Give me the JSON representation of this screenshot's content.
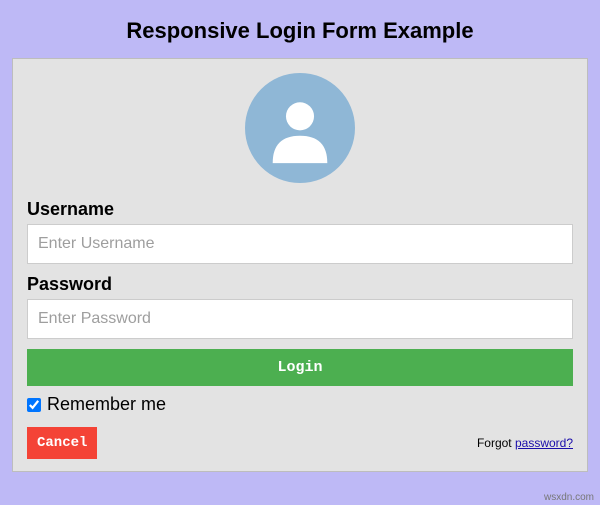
{
  "page_title": "Responsive Login Form Example",
  "form": {
    "username": {
      "label": "Username",
      "placeholder": "Enter Username"
    },
    "password": {
      "label": "Password",
      "placeholder": "Enter Password"
    },
    "login_button": "Login",
    "remember_label": "Remember me",
    "remember_checked": true,
    "cancel_button": "Cancel",
    "forgot_prefix": "Forgot ",
    "forgot_link": "password?"
  },
  "watermark": "wsxdn.com"
}
